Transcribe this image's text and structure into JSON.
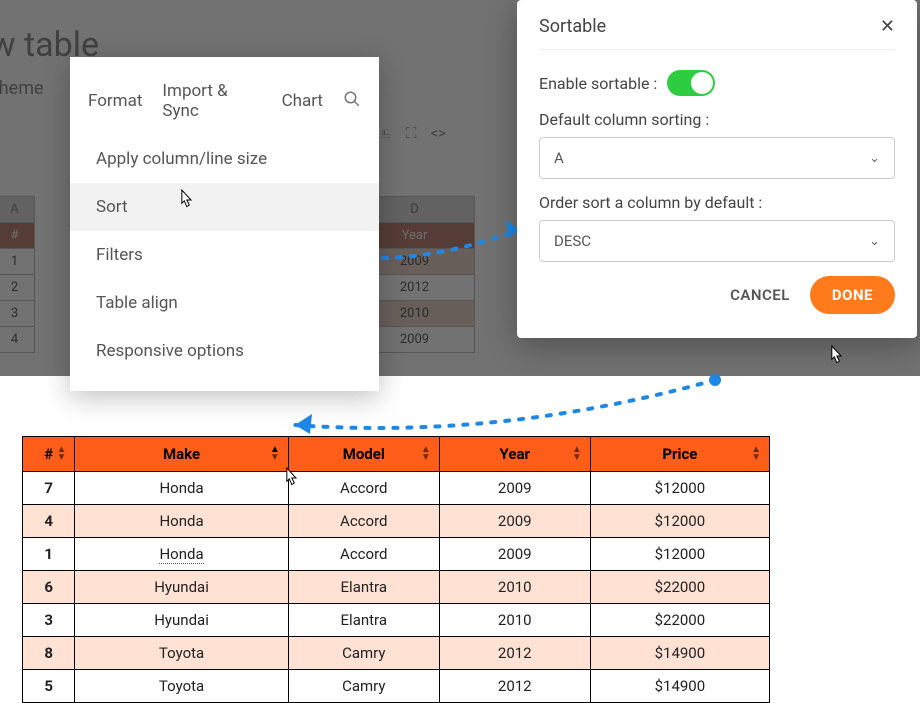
{
  "background": {
    "title": "ew table",
    "tab_theme": "Theme",
    "col_letters": [
      "A",
      "D"
    ],
    "header_cells": [
      "#",
      "Year"
    ],
    "year_values": [
      "2009",
      "2012",
      "2010",
      "2009"
    ]
  },
  "dropdown": {
    "tabs": {
      "format": "Format",
      "import_sync": "Import & Sync",
      "chart": "Chart"
    },
    "items": {
      "apply_size": "Apply column/line size",
      "sort": "Sort",
      "filters": "Filters",
      "table_align": "Table align",
      "responsive": "Responsive options"
    }
  },
  "modal": {
    "title": "Sortable",
    "enable_label": "Enable sortable :",
    "default_col_label": "Default column sorting :",
    "default_col_value": "A",
    "order_label": "Order sort a column by default :",
    "order_value": "DESC",
    "cancel": "CANCEL",
    "done": "DONE"
  },
  "result_table": {
    "headers": {
      "idx": "#",
      "make": "Make",
      "model": "Model",
      "year": "Year",
      "price": "Price"
    },
    "rows": [
      {
        "idx": "7",
        "make": "Honda",
        "model": "Accord",
        "year": "2009",
        "price": "$12000"
      },
      {
        "idx": "4",
        "make": "Honda",
        "model": "Accord",
        "year": "2009",
        "price": "$12000"
      },
      {
        "idx": "1",
        "make": "Honda",
        "model": "Accord",
        "year": "2009",
        "price": "$12000"
      },
      {
        "idx": "6",
        "make": "Hyundai",
        "model": "Elantra",
        "year": "2010",
        "price": "$22000"
      },
      {
        "idx": "3",
        "make": "Hyundai",
        "model": "Elantra",
        "year": "2010",
        "price": "$22000"
      },
      {
        "idx": "8",
        "make": "Toyota",
        "model": "Camry",
        "year": "2012",
        "price": "$14900"
      },
      {
        "idx": "5",
        "make": "Toyota",
        "model": "Camry",
        "year": "2012",
        "price": "$14900"
      }
    ]
  }
}
